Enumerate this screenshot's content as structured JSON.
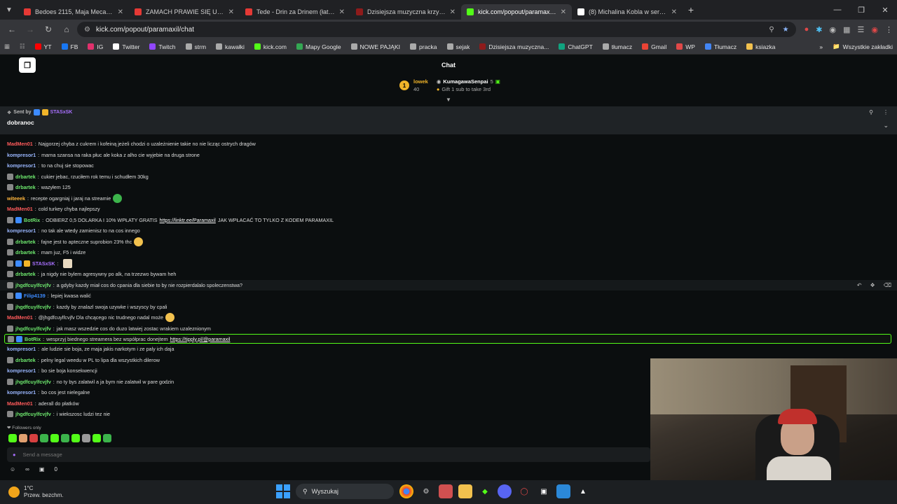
{
  "browser": {
    "tabs": [
      {
        "title": "Bedoes 2115, Maja Mecan, Cam",
        "color": "#e53935",
        "active": false
      },
      {
        "title": "ZAMACH PRAWIE SIĘ UDAŁ - Yo",
        "color": "#e53935",
        "active": false
      },
      {
        "title": "Tede - Drin za Drinem (łatwogo",
        "color": "#e53935",
        "active": false
      },
      {
        "title": "Dzisiejsza muzyczna krzyżówka",
        "color": "#8e1b1b",
        "active": false
      },
      {
        "title": "kick.com/popout/paramaxil/ch",
        "color": "#53fc18",
        "active": true
      },
      {
        "title": "(8) Michalina Kobla w serwisie X",
        "color": "#ffffff",
        "active": false
      }
    ],
    "url": "kick.com/popout/paramaxil/chat",
    "bookmarks": [
      "YT",
      "FB",
      "IG",
      "Twitter",
      "Twitch",
      "strm",
      "kawałki",
      "kick.com",
      "Mapy Google",
      "NOWE PAJĄKI",
      "pracka",
      "sejak",
      "Dzisiejsza muzyczna...",
      "ChatGPT",
      "tłumacz",
      "Gmail",
      "WP",
      "Tłumacz",
      "ksiazka"
    ],
    "bookmarks_all": "Wszystkie zakładki"
  },
  "chat": {
    "header_title": "Chat",
    "logo": "❐",
    "leaderboard": {
      "rank": "1",
      "first_name": "lowek",
      "first_count": "40",
      "second_name": "KumagawaSenpai",
      "second_count": "5",
      "gift_text": "Gift 1 sub to take 3rd"
    },
    "pinned": {
      "sent_by_label": "Sent by",
      "sender": "STASxSK",
      "message": "dobranoc"
    },
    "messages": [
      {
        "user": "MadMen01",
        "color": "#ff5b5b",
        "text": "Najgorzej chyba z cukrem i kofeiną jeżeli chodzi o uzależnienie takie no nie licząc ostrych dragów",
        "badges": 0
      },
      {
        "user": "kompresor1",
        "color": "#9ab7ff",
        "text": "marna szansa na raka płuc ale koka z alho cie wyjebie na druga strone",
        "badges": 0
      },
      {
        "user": "kompresor1",
        "color": "#9ab7ff",
        "text": "to na chuj sie stopowac",
        "badges": 0
      },
      {
        "user": "drbartek",
        "color": "#6ee86e",
        "text": "cukier jebac, rzuciłem rok temu i schudłem 30kg",
        "badges": 1
      },
      {
        "user": "drbartek",
        "color": "#6ee86e",
        "text": "wazyłem 125",
        "badges": 1
      },
      {
        "user": "witeeek",
        "color": "#ffb63d",
        "text": "recepte ogargniaj i jaraj na streamie",
        "badges": 0
      },
      {
        "user": "MadMen01",
        "color": "#ff5b5b",
        "text": "cold turkey chyba najlepszy",
        "badges": 0
      },
      {
        "user": "BotRix",
        "color": "#6ee86e",
        "text": "ODBIERZ 0,5 DOLARKA I 10% WPŁATY GRATIS",
        "link": "https://linktr.ee/Paramaxil",
        "after": "JAK WPŁACAĆ TO TYLKO Z KODEM PARAMAXIL",
        "badges": 2
      },
      {
        "user": "kompresor1",
        "color": "#9ab7ff",
        "text": "no tak ale wtedy zamienisz to na cos innego",
        "badges": 0
      },
      {
        "user": "drbartek",
        "color": "#6ee86e",
        "text": "fajne jest to apteczne suprobion 23% thc",
        "badges": 1
      },
      {
        "user": "drbartek",
        "color": "#6ee86e",
        "text": "mam juz, F5 i widze",
        "badges": 1
      },
      {
        "user": "STASxSK",
        "color": "#a970ff",
        "text": "",
        "badges": 3
      },
      {
        "user": "drbartek",
        "color": "#6ee86e",
        "text": "ja nigdy nie bylem agresywny po alk, na trzezwo bywam heh",
        "badges": 1
      },
      {
        "user": "jhgdfcuylfcvjfv",
        "color": "#6ee86e",
        "text": "a gdyby kazdy miał cos do cpania dla siebie to by nie rozpierdalalo spoleczenstwa?",
        "badges": 1,
        "hover": true
      },
      {
        "user": "Filip4139",
        "color": "#3d8bff",
        "text": "lepiej kwasa walić",
        "badges": 2
      },
      {
        "user": "jhgdfcuylfcvjfv",
        "color": "#6ee86e",
        "text": "kazdy by znalazl swoja uzywke i wszyscy by cpali",
        "badges": 1
      },
      {
        "user": "MadMen01",
        "color": "#ff5b5b",
        "text": "@jhgdfcuylfcvjfv Dla chcącego nic trudnego nadal może",
        "badges": 0
      },
      {
        "user": "jhgdfcuylfcvjfv",
        "color": "#6ee86e",
        "text": "jak masz wszedzie cos do duzo latwiej zostac wrakiem uzaleznionym",
        "badges": 1
      },
      {
        "user": "BotRix",
        "color": "#6ee86e",
        "text": "wesprzyj biednego streamera bez współprac donejtem",
        "link": "https://tipply.pl/@paramaxil",
        "after": "",
        "badges": 2,
        "highlight": true
      },
      {
        "user": "kompresor1",
        "color": "#9ab7ff",
        "text": "ale ludzie sie boja, ze maja jakis narkotym i ze paly ich daja",
        "badges": 0
      },
      {
        "user": "drbartek",
        "color": "#6ee86e",
        "text": "pelny legal weedu w PL to lipa dla wszystkich dilerow",
        "badges": 1
      },
      {
        "user": "kompresor1",
        "color": "#9ab7ff",
        "text": "bo sie boja konsekwencji",
        "badges": 0
      },
      {
        "user": "jhgdfcuylfcvjfv",
        "color": "#6ee86e",
        "text": "no ty bys zalatwil a ja bym nie zalatwil w pare godzin",
        "badges": 1
      },
      {
        "user": "kompresor1",
        "color": "#9ab7ff",
        "text": "bo cos jest nielegalne",
        "badges": 0
      },
      {
        "user": "MadMen01",
        "color": "#ff5b5b",
        "text": "aderall do płatków",
        "badges": 0
      },
      {
        "user": "jhgdfcuylfcvjfv",
        "color": "#6ee86e",
        "text": "i wiekszosc ludzi tez nie",
        "badges": 1
      }
    ],
    "followers_only": "Followers only",
    "send_placeholder": "Send a message",
    "tools_count_a": "∞",
    "tools_count_b": "0"
  },
  "taskbar": {
    "temp": "1°C",
    "weather_desc": "Przew. bezchm.",
    "search_label": "Wyszukaj"
  }
}
